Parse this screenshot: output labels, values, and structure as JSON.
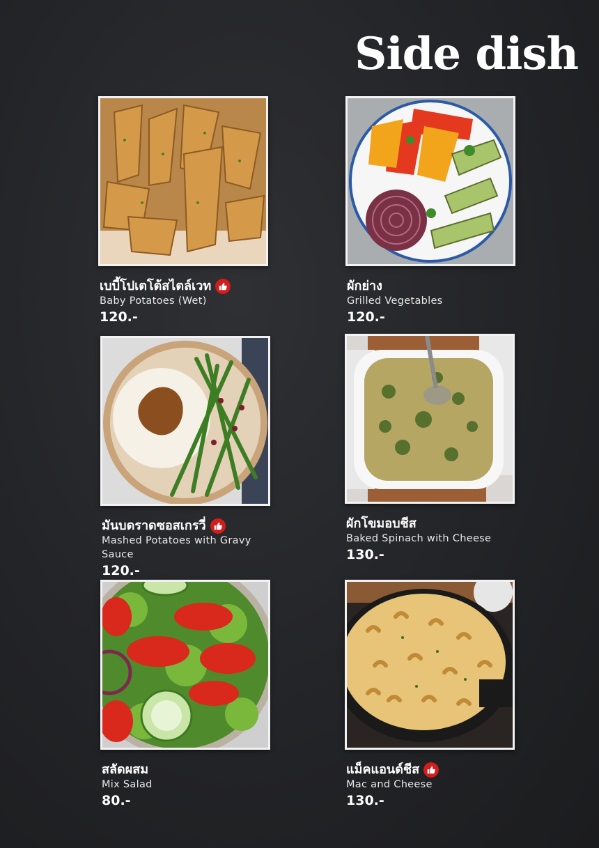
{
  "page": {
    "title": "Side dish"
  },
  "items": [
    {
      "thai": "เบบี้โปเตโต้สไตล์เวท",
      "english": "Baby Potatoes (Wet)",
      "price": "120.-",
      "recommended": true,
      "image": "potato-wedges-photo"
    },
    {
      "thai": "ผักย่าง",
      "english": "Grilled Vegetables",
      "price": "120.-",
      "recommended": false,
      "image": "grilled-vegetables-photo"
    },
    {
      "thai": "มันบดราดซอสเกรวี่",
      "english": "Mashed Potatoes with Gravy Sauce",
      "price": "120.-",
      "recommended": true,
      "image": "mashed-potatoes-photo"
    },
    {
      "thai": "ผักโขมอบชีส",
      "english": "Baked Spinach with Cheese",
      "price": "130.-",
      "recommended": false,
      "image": "baked-spinach-photo"
    },
    {
      "thai": "สลัดผสม",
      "english": "Mix Salad",
      "price": "80.-",
      "recommended": false,
      "image": "mix-salad-photo"
    },
    {
      "thai": "แม็คแอนด์ชีส",
      "english": "Mac and Cheese",
      "price": "130.-",
      "recommended": true,
      "image": "mac-and-cheese-photo"
    }
  ],
  "colors": {
    "background": "#232427",
    "recommend_badge": "#d31d1d",
    "frame": "#f2f2f2"
  }
}
